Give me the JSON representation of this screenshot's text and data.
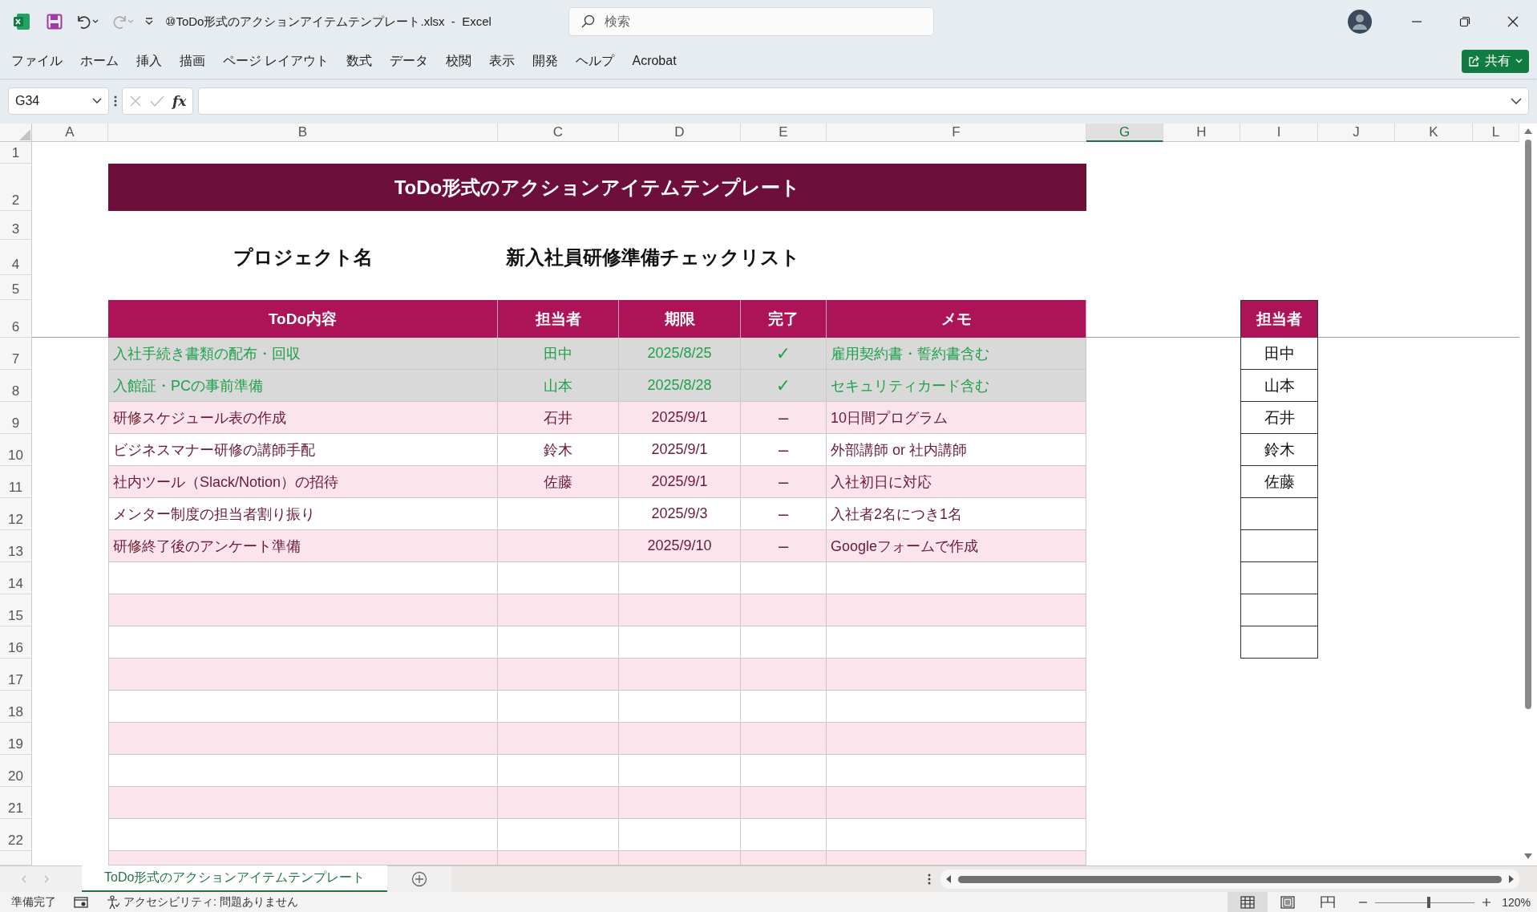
{
  "window": {
    "title": "⑩ToDo形式のアクションアイテムテンプレート.xlsx  -  Excel",
    "search_placeholder": "検索"
  },
  "ribbon_tabs": [
    "ファイル",
    "ホーム",
    "挿入",
    "描画",
    "ページ レイアウト",
    "数式",
    "データ",
    "校閲",
    "表示",
    "開発",
    "ヘルプ",
    "Acrobat"
  ],
  "share_button": "共有",
  "name_box": "G34",
  "formula_bar": {
    "fx_label": "fx"
  },
  "columns": [
    {
      "label": "A",
      "selected": false
    },
    {
      "label": "B",
      "selected": false
    },
    {
      "label": "C",
      "selected": false
    },
    {
      "label": "D",
      "selected": false
    },
    {
      "label": "E",
      "selected": false
    },
    {
      "label": "F",
      "selected": false
    },
    {
      "label": "G",
      "selected": true
    },
    {
      "label": "H",
      "selected": false
    },
    {
      "label": "I",
      "selected": false
    },
    {
      "label": "J",
      "selected": false
    },
    {
      "label": "K",
      "selected": false
    },
    {
      "label": "L",
      "selected": false
    }
  ],
  "row_numbers": [
    "1",
    "2",
    "3",
    "4",
    "5",
    "6",
    "7",
    "8",
    "9",
    "10",
    "11",
    "12",
    "13",
    "14",
    "15",
    "16",
    "17",
    "18",
    "19",
    "20",
    "21",
    "22"
  ],
  "sheet": {
    "title": "ToDo形式のアクションアイテムテンプレート",
    "project_label": "プロジェクト名",
    "project_name": "新入社員研修準備チェックリスト",
    "table": {
      "columns": [
        "ToDo内容",
        "担当者",
        "期限",
        "完了",
        "メモ"
      ],
      "rows": [
        {
          "todo": "入社手続き書類の配布・回収",
          "assignee": "田中",
          "due": "2025/8/25",
          "status": "✓",
          "memo": "雇用契約書・誓約書含む",
          "done": true
        },
        {
          "todo": "入館証・PCの事前準備",
          "assignee": "山本",
          "due": "2025/8/28",
          "status": "✓",
          "memo": "セキュリティカード含む",
          "done": true
        },
        {
          "todo": "研修スケジュール表の作成",
          "assignee": "石井",
          "due": "2025/9/1",
          "status": "–",
          "memo": "10日間プログラム",
          "done": false
        },
        {
          "todo": "ビジネスマナー研修の講師手配",
          "assignee": "鈴木",
          "due": "2025/9/1",
          "status": "–",
          "memo": "外部講師 or 社内講師",
          "done": false
        },
        {
          "todo": "社内ツール（Slack/Notion）の招待",
          "assignee": "佐藤",
          "due": "2025/9/1",
          "status": "–",
          "memo": "入社初日に対応",
          "done": false
        },
        {
          "todo": "メンター制度の担当者割り振り",
          "due": "2025/9/3",
          "status": "–",
          "memo": "入社者2名につき1名",
          "done": false
        },
        {
          "todo": "研修終了後のアンケート準備",
          "due": "2025/9/10",
          "status": "–",
          "memo": "Googleフォームで作成",
          "done": false
        }
      ]
    },
    "assignees": {
      "header": "担当者",
      "items": [
        "田中",
        "山本",
        "石井",
        "鈴木",
        "佐藤"
      ]
    }
  },
  "sheet_tabs": [
    {
      "label": "ToDo形式のアクションアイテムテンプレート",
      "selected": true
    }
  ],
  "status_bar": {
    "ready": "準備完了",
    "accessibility": "アクセシビリティ: 問題ありません",
    "views": [
      {
        "kind": "normal",
        "selected": true
      },
      {
        "kind": "page-layout",
        "selected": false
      },
      {
        "kind": "page-break",
        "selected": false
      }
    ],
    "zoom": {
      "level": 0.54,
      "reading": "120%"
    }
  }
}
